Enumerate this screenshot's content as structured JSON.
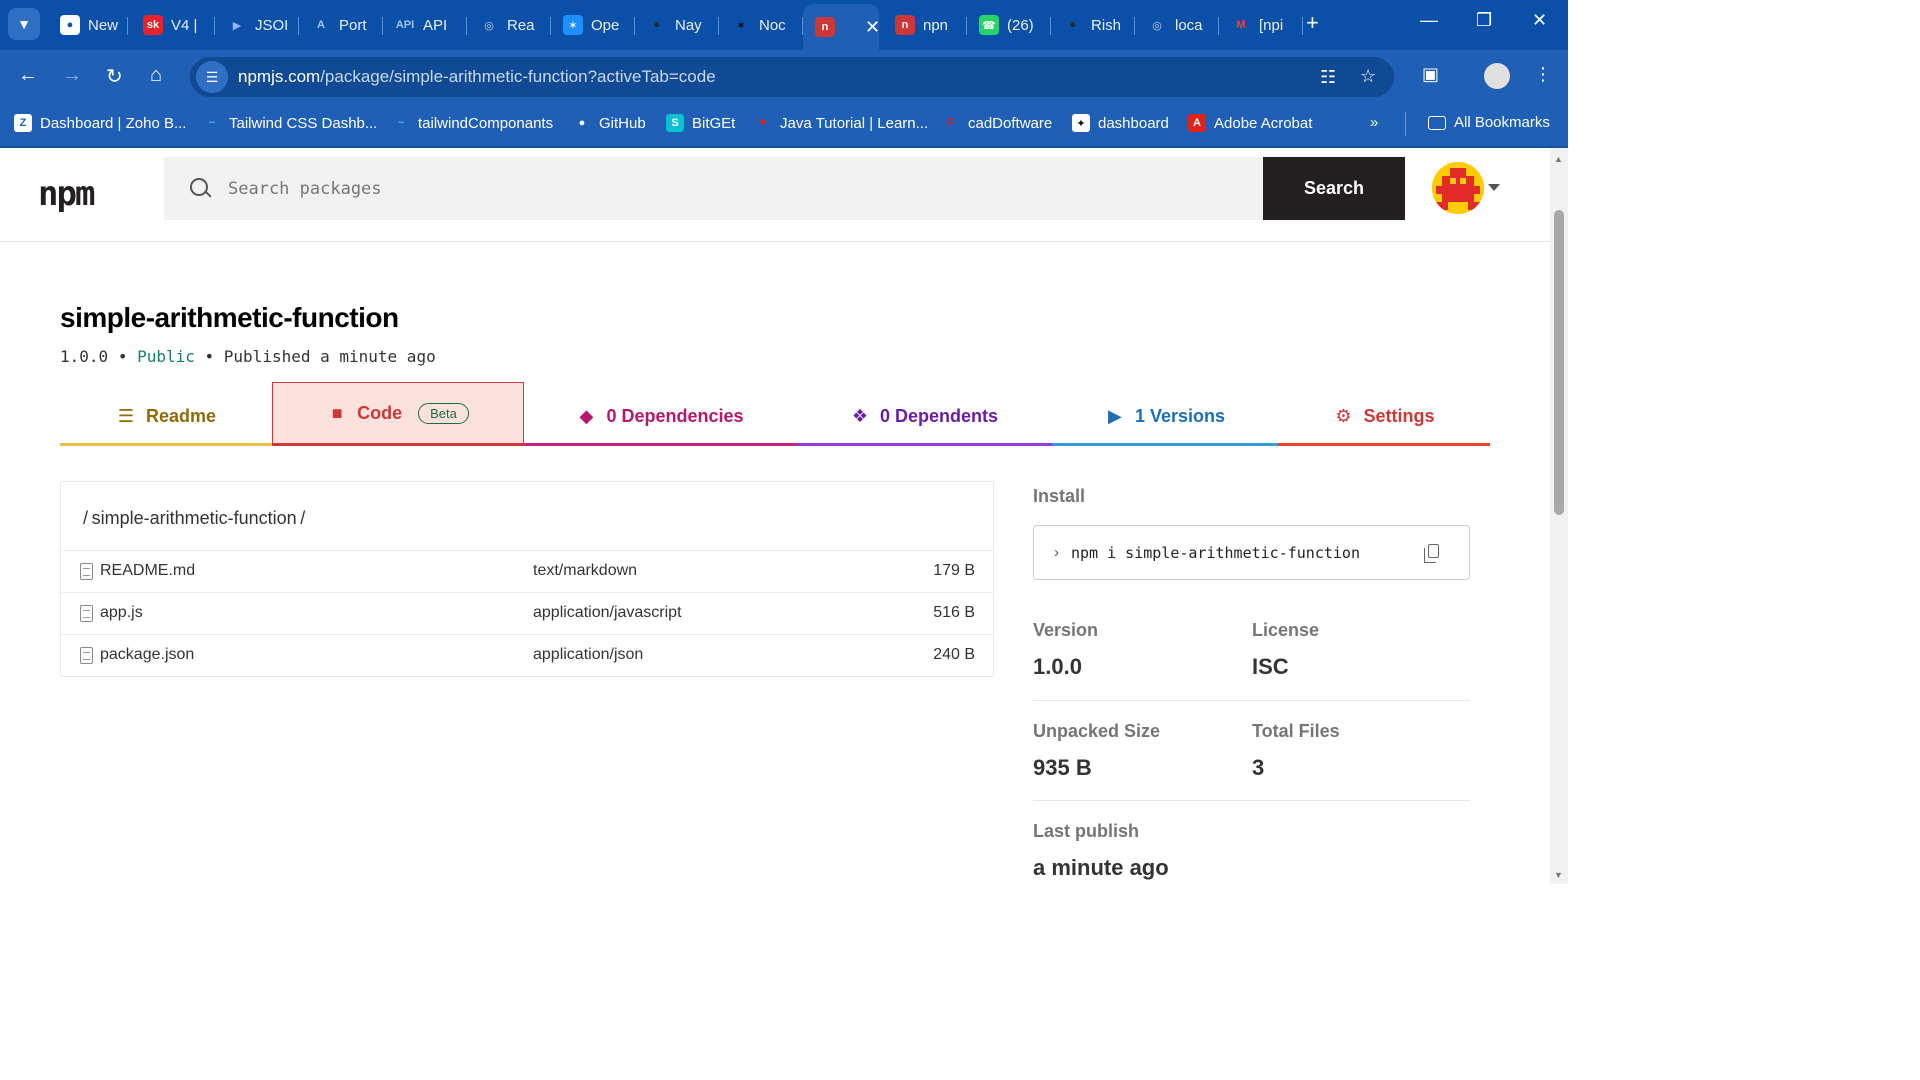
{
  "browser": {
    "tabs": [
      {
        "label": "New",
        "fav": "●",
        "favBg": "#ffffff",
        "favFg": "#0a4fa8"
      },
      {
        "label": "V4 |",
        "fav": "sk",
        "favBg": "#e8232a",
        "favFg": "#ffffff"
      },
      {
        "label": "JSOI",
        "fav": "▶",
        "favBg": "transparent",
        "favFg": "#8fb4ff"
      },
      {
        "label": "Port",
        "fav": "A",
        "favBg": "transparent",
        "favFg": "#9ec8ff"
      },
      {
        "label": "API",
        "fav": "API",
        "favBg": "transparent",
        "favFg": "#9ec8ff"
      },
      {
        "label": "Rea",
        "fav": "◎",
        "favBg": "transparent",
        "favFg": "#c8d4e6"
      },
      {
        "label": "Ope",
        "fav": "✶",
        "favBg": "#1e8fff",
        "favFg": "#ffffff"
      },
      {
        "label": "Nay",
        "fav": "●",
        "favBg": "transparent",
        "favFg": "#23262b"
      },
      {
        "label": "Noc",
        "fav": "✶",
        "favBg": "transparent",
        "favFg": "#000000"
      },
      {
        "label": "",
        "fav": "n",
        "favBg": "#cb3837",
        "favFg": "#ffffff"
      },
      {
        "label": "npn",
        "fav": "n",
        "favBg": "#cb3837",
        "favFg": "#ffffff"
      },
      {
        "label": "(26)",
        "fav": "☎",
        "favBg": "#25d366",
        "favFg": "#ffffff"
      },
      {
        "label": "Rish",
        "fav": "●",
        "favBg": "transparent",
        "favFg": "#23262b"
      },
      {
        "label": "loca",
        "fav": "◎",
        "favBg": "transparent",
        "favFg": "#c8d4e6"
      },
      {
        "label": "[npi",
        "fav": "M",
        "favBg": "transparent",
        "favFg": "#ea4335"
      }
    ],
    "url_host": "npmjs.com",
    "url_path": "/package/simple-arithmetic-function?activeTab=code",
    "bookmarks": [
      {
        "label": "Dashboard | Zoho B...",
        "icon": "Z",
        "bg": "#ffffff",
        "fg": "#1f5fb5"
      },
      {
        "label": "Tailwind CSS Dashb...",
        "icon": "~",
        "bg": "transparent",
        "fg": "#38bdf8"
      },
      {
        "label": "tailwindComponants",
        "icon": "~",
        "bg": "transparent",
        "fg": "#38bdf8"
      },
      {
        "label": "GitHub",
        "icon": "●",
        "bg": "transparent",
        "fg": "#ffffff"
      },
      {
        "label": "BitGEt",
        "icon": "S",
        "bg": "#00c2d1",
        "fg": "#ffffff"
      },
      {
        "label": "Java Tutorial | Learn...",
        "icon": "▼",
        "bg": "transparent",
        "fg": "#e51d1d"
      },
      {
        "label": "cadDoftware",
        "icon": "F",
        "bg": "transparent",
        "fg": "#e51d1d"
      },
      {
        "label": "dashboard",
        "icon": "✦",
        "bg": "#ffffff",
        "fg": "#111111"
      },
      {
        "label": "Adobe Acrobat",
        "icon": "A",
        "bg": "#e0231b",
        "fg": "#ffffff"
      }
    ],
    "more": "»",
    "all_bookmarks": "All Bookmarks"
  },
  "npm": {
    "logo": "npm",
    "search_placeholder": "Search packages",
    "search_button": "Search",
    "package": {
      "name": "simple-arithmetic-function",
      "version": "1.0.0",
      "visibility": "Public",
      "published": "Published a minute ago"
    },
    "tabs": [
      {
        "label": "Readme",
        "color": "#8a6d0b",
        "line": "#e6c343",
        "icon": "☰"
      },
      {
        "label": "Code",
        "color": "#cb3837",
        "line": "#cb3837",
        "icon": "■",
        "badge": "Beta"
      },
      {
        "label": "0 Dependencies",
        "color": "#b3186e",
        "line": "#c6257e",
        "icon": "◆"
      },
      {
        "label": "0 Dependents",
        "color": "#6b1ea3",
        "line": "#9a3bd6",
        "icon": "❖"
      },
      {
        "label": "1 Versions",
        "color": "#1b6fb2",
        "line": "#3b9ad8",
        "icon": "▶"
      },
      {
        "label": "Settings",
        "color": "#cb3837",
        "line": "#e8442f",
        "icon": "⚙"
      }
    ],
    "files": {
      "path": "/ simple-arithmetic-function /",
      "rows": [
        {
          "name": "README.md",
          "type": "text/markdown",
          "size": "179 B"
        },
        {
          "name": "app.js",
          "type": "application/javascript",
          "size": "516 B"
        },
        {
          "name": "package.json",
          "type": "application/json",
          "size": "240 B"
        }
      ]
    },
    "sidebar": {
      "install_label": "Install",
      "install_cmd": "npm i simple-arithmetic-function",
      "version_label": "Version",
      "version": "1.0.0",
      "license_label": "License",
      "license": "ISC",
      "unpacked_label": "Unpacked Size",
      "unpacked": "935 B",
      "total_files_label": "Total Files",
      "total_files": "3",
      "last_publish_label": "Last publish",
      "last_publish": "a minute ago"
    }
  }
}
